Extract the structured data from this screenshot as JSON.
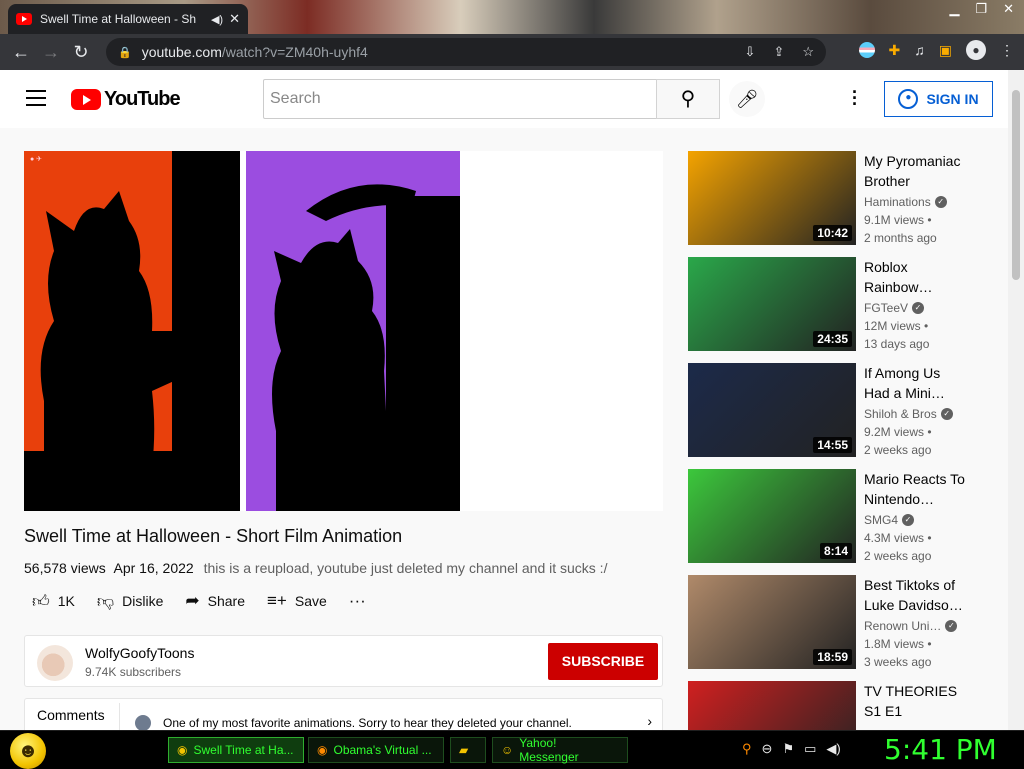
{
  "browser": {
    "tab_title": "Swell Time at Halloween - Sh",
    "address_host": "youtube.com",
    "address_path": "/watch?v=ZM40h-uyhf4"
  },
  "header": {
    "logo_text": "YouTube",
    "search_placeholder": "Search",
    "sign_in_label": "SIGN IN"
  },
  "video": {
    "title": "Swell Time at Halloween - Short Film Animation",
    "views": "56,578 views",
    "date": "Apr 16, 2022",
    "description": "this is a reupload, youtube just deleted my channel and it sucks :/",
    "like_count": "1K",
    "dislike_label": "Dislike",
    "share_label": "Share",
    "save_label": "Save"
  },
  "channel": {
    "name": "WolfyGoofyToons",
    "subscribers": "9.74K subscribers",
    "subscribe_label": "SUBSCRIBE"
  },
  "comments": {
    "label": "Comments",
    "preview": "One of my most favorite animations. Sorry to hear they deleted your channel."
  },
  "recommended": [
    {
      "title": "My Pyromaniac Brother",
      "channel": "Haminations",
      "views": "9.1M views •",
      "age": "2 months ago",
      "duration": "10:42",
      "color": "#f4a300"
    },
    {
      "title": "Roblox Rainbow…",
      "channel": "FGTeeV",
      "views": "12M views •",
      "age": "13 days ago",
      "duration": "24:35",
      "color": "#2aa84a"
    },
    {
      "title": "If Among Us Had a Mini…",
      "channel": "Shiloh & Bros",
      "views": "9.2M views •",
      "age": "2 weeks ago",
      "duration": "14:55",
      "color": "#1c2a4a"
    },
    {
      "title": "Mario Reacts To Nintendo…",
      "channel": "SMG4",
      "views": "4.3M views •",
      "age": "2 weeks ago",
      "duration": "8:14",
      "color": "#3cc83c"
    },
    {
      "title": "Best Tiktoks of Luke Davidso…",
      "channel": "Renown Uni…",
      "views": "1.8M views •",
      "age": "3 weeks ago",
      "duration": "18:59",
      "color": "#b08a6a"
    },
    {
      "title": "TV THEORIES S1 E1",
      "channel": "",
      "views": "",
      "age": "",
      "duration": "",
      "color": "#d02020"
    }
  ],
  "taskbar": {
    "items": [
      "Swell Time at Ha...",
      "Obama's Virtual ...",
      "Yahoo! Messenger"
    ],
    "clock": "5:41 PM"
  }
}
